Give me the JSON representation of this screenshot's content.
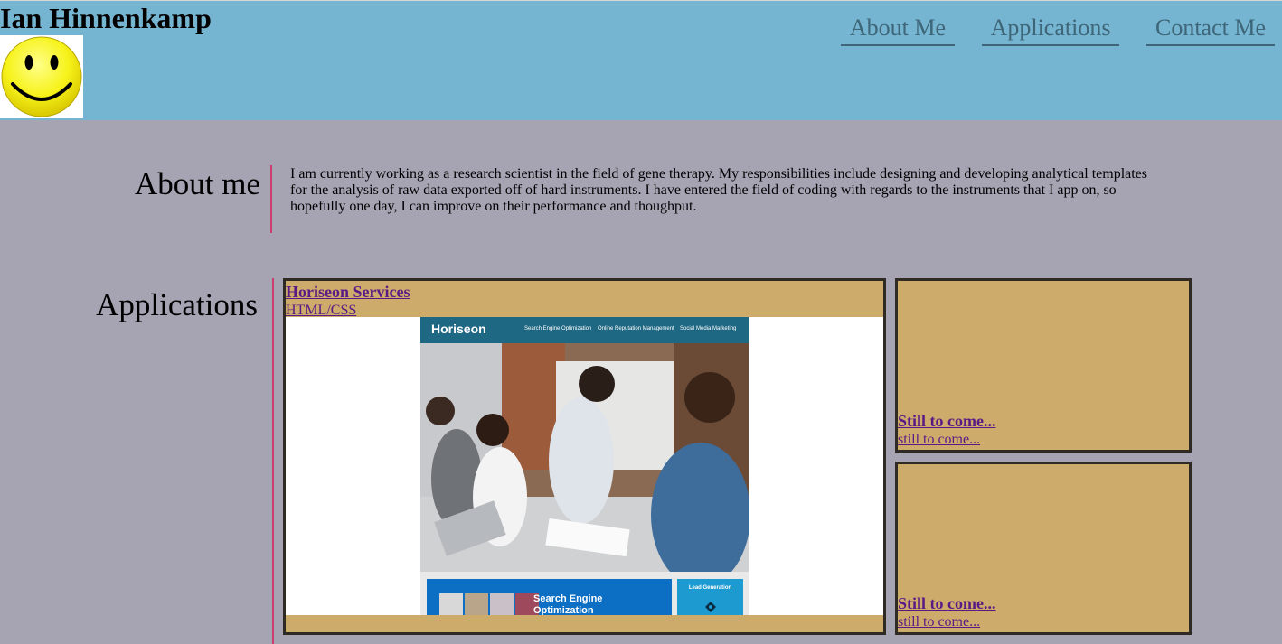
{
  "header": {
    "site_name": "Ian Hinnenkamp",
    "avatar_icon": "smiley-face-icon",
    "nav": {
      "about": "About Me",
      "applications": "Applications",
      "contact": "Contact Me"
    }
  },
  "about": {
    "heading": "About me",
    "text": "I am currently working as a research scientist in the field of gene therapy. My responsibilities include designing and developing analytical templates for the analysis of raw data exported off of hard instruments. I have entered the field of coding with regards to the instruments that I app on, so hopefully one day, I can improve on their performance and thoughput."
  },
  "applications": {
    "heading": "Applications",
    "featured": {
      "title": "Horiseon Services",
      "subtitle": "HTML/CSS",
      "screenshot": {
        "brand": "Horiseon",
        "nav": [
          "Search Engine Optimization",
          "Online Reputation Management",
          "Social Media Marketing"
        ],
        "card_label": "Search Engine Optimization",
        "side_label": "Lead Generation"
      }
    },
    "placeholders": [
      {
        "title": "Still to come...",
        "subtitle": "still to come..."
      },
      {
        "title": "Still to come...",
        "subtitle": "still to come..."
      }
    ]
  },
  "colors": {
    "header_bg": "#76b5d1",
    "page_bg": "#a6a3b3",
    "card_bg": "#cdab6a",
    "accent_divider": "#cc3d70",
    "link": "#5a1a86"
  }
}
